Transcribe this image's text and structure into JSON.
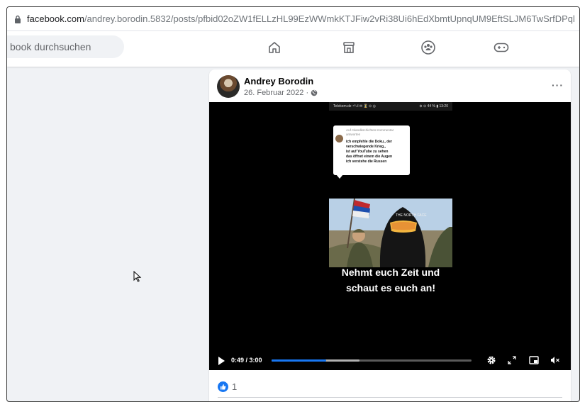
{
  "browser": {
    "url_domain": "facebook.com",
    "url_path": "/andrey.borodin.5832/posts/pfbid02oZW1fELLzHL99EzWWmkKTJFiw2vRi38Ui6hEdXbmtUpnqUM9EftSLJM6TwSrfDPql"
  },
  "navbar": {
    "search_placeholder": "book durchsuchen",
    "icons": [
      "home-icon",
      "marketplace-icon",
      "groups-icon",
      "gaming-icon"
    ]
  },
  "post": {
    "author": "Andrey Borodin",
    "date": "26. Februar 2022 · ",
    "privacy_icon": "globe-icon",
    "more_label": "···",
    "video": {
      "status_left": "Telekom.de ⁴ᴳ.ıl ✉ ⏳ ⊙ ◎",
      "status_right": "⊚ ⊙ 44 % ▮ 13:20",
      "reply_label": "Auf mlandkschichtes Kommentar antworten",
      "comment_lines": [
        "ich empfehle die Doku,, der",
        "verschwiegende Krieg,,",
        "ist auf YouTube zu sehen",
        "das öffnet einem die Augen",
        "ich verstehe die Russen"
      ],
      "caption_line1": "Nehmt euch Zeit und",
      "caption_line2": "schaut es euch an!",
      "time_display": "0:49 / 3:00",
      "progress_fraction": 0.272,
      "buffered_fraction": 0.44,
      "control_icons": [
        "settings-icon",
        "fullscreen-icon",
        "miniplayer-icon",
        "mute-icon"
      ]
    },
    "reactions": {
      "icon": "like-icon",
      "count": "1"
    }
  },
  "colors": {
    "accent": "#1877f2",
    "page_bg": "#f0f2f5",
    "video_bg": "#000000"
  }
}
